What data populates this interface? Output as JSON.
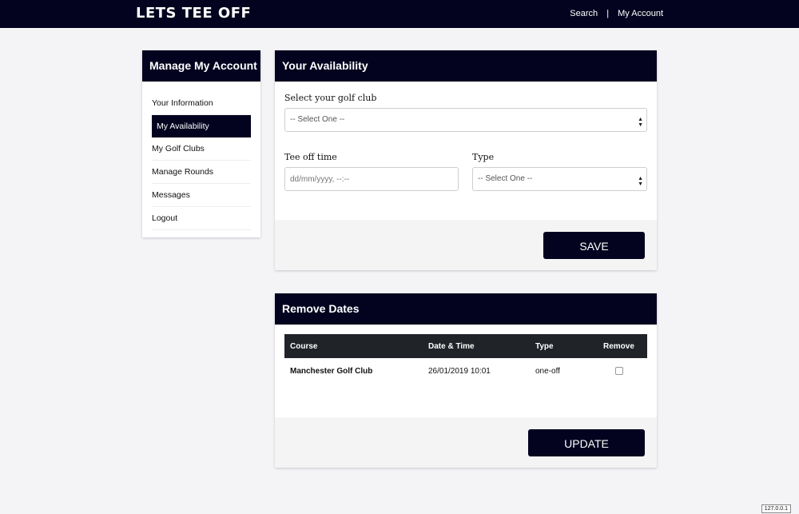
{
  "header": {
    "brand": "LETS TEE OFF",
    "nav": [
      "Search",
      "My Account"
    ],
    "separator": "|"
  },
  "sidebar": {
    "title": "Manage My Account",
    "items": [
      {
        "label": "Your Information",
        "active": false
      },
      {
        "label": "My Availability",
        "active": true
      },
      {
        "label": "My Golf Clubs",
        "active": false
      },
      {
        "label": "Manage Rounds",
        "active": false
      },
      {
        "label": "Messages",
        "active": false
      },
      {
        "label": "Logout",
        "active": false
      }
    ]
  },
  "availability": {
    "title": "Your Availability",
    "club_label": "Select your golf club",
    "club_value": "-- Select One --",
    "tee_label": "Tee off time",
    "tee_placeholder": "dd/mm/yyyy, --:--",
    "type_label": "Type",
    "type_value": "-- Select One --",
    "save_label": "SAVE"
  },
  "remove": {
    "title": "Remove Dates",
    "columns": [
      "Course",
      "Date & Time",
      "Type",
      "Remove"
    ],
    "rows": [
      {
        "course": "Manchester Golf Club",
        "datetime": "26/01/2019 10:01",
        "type": "one-off",
        "remove": false
      }
    ],
    "update_label": "UPDATE"
  },
  "status": {
    "host": "127.0.0.1"
  },
  "colors": {
    "brand_navy": "#03031f",
    "table_header": "#202328",
    "page_bg": "#f4f4f7"
  }
}
